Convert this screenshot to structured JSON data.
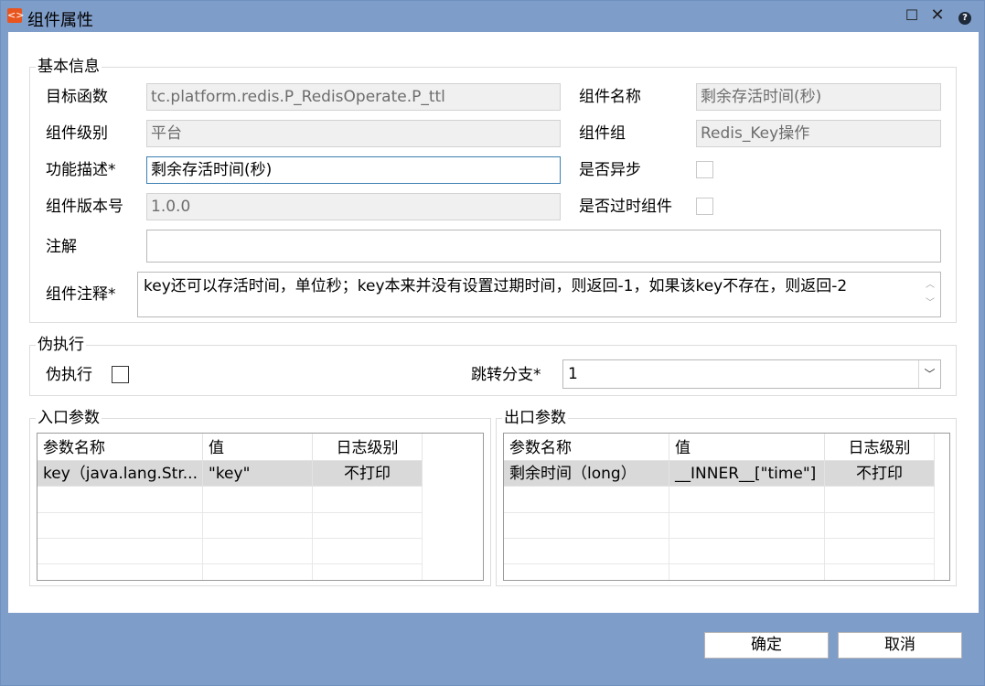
{
  "window": {
    "title": "组件属性",
    "maximize_icon": "maximize-icon",
    "close_icon": "close-icon",
    "help_icon": "help-icon",
    "app_icon_glyph": "<>",
    "close_glyph": "✕",
    "maximize_glyph": "☐",
    "help_glyph": "?"
  },
  "basic_info": {
    "legend": "基本信息",
    "target_function_label": "目标函数",
    "target_function_value": "tc.platform.redis.P_RedisOperate.P_ttl",
    "component_name_label": "组件名称",
    "component_name_value": "剩余存活时间(秒)",
    "component_level_label": "组件级别",
    "component_level_value": "平台",
    "component_group_label": "组件组",
    "component_group_value": "Redis_Key操作",
    "description_label": "功能描述*",
    "description_value": "剩余存活时间(秒)",
    "async_label": "是否异步",
    "version_label": "组件版本号",
    "version_value": "1.0.0",
    "deprecated_label": "是否过时组件",
    "annotation_label": "注解",
    "annotation_value": "",
    "comment_label": "组件注释*",
    "comment_value": "key还可以存活时间，单位秒；key本来并没有设置过期时间，则返回-1，如果该key不存在，则返回-2"
  },
  "pseudo_exec": {
    "legend": "伪执行",
    "pseudo_label": "伪执行",
    "jump_label": "跳转分支*",
    "jump_value": "1"
  },
  "input_params": {
    "legend": "入口参数",
    "columns": [
      "参数名称",
      "值",
      "日志级别"
    ],
    "rows": [
      [
        "key（java.lang.Str...",
        "\"key\"",
        "不打印"
      ]
    ]
  },
  "output_params": {
    "legend": "出口参数",
    "columns": [
      "参数名称",
      "值",
      "日志级别"
    ],
    "rows": [
      [
        "剩余时间（long）",
        "__INNER__[\"time\"]",
        "不打印"
      ]
    ]
  },
  "footer": {
    "ok_label": "确定",
    "cancel_label": "取消"
  }
}
